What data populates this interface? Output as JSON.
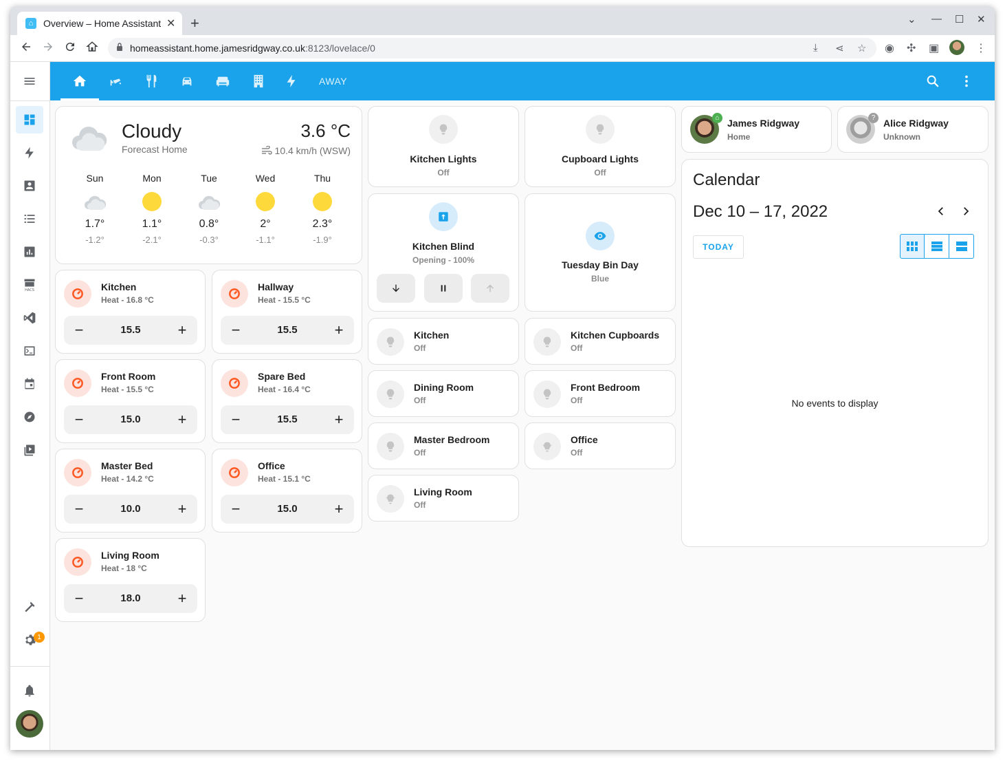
{
  "browser": {
    "tab_title": "Overview – Home Assistant",
    "url_host": "homeassistant.home.jamesridgway.co.uk",
    "url_path": ":8123/lovelace/0"
  },
  "header": {
    "away_label": "AWAY"
  },
  "weather": {
    "condition": "Cloudy",
    "name": "Forecast Home",
    "temperature": "3.6 °C",
    "wind": "10.4 km/h (WSW)",
    "forecast": [
      {
        "day": "Sun",
        "icon": "cloudy",
        "high": "1.7°",
        "low": "-1.2°"
      },
      {
        "day": "Mon",
        "icon": "sunny",
        "high": "1.1°",
        "low": "-2.1°"
      },
      {
        "day": "Tue",
        "icon": "cloudy",
        "high": "0.8°",
        "low": "-0.3°"
      },
      {
        "day": "Wed",
        "icon": "sunny",
        "high": "2°",
        "low": "-1.1°"
      },
      {
        "day": "Thu",
        "icon": "sunny",
        "high": "2.3°",
        "low": "-1.9°"
      }
    ]
  },
  "thermostats": [
    {
      "name": "Kitchen",
      "state": "Heat - 16.8 °C",
      "target": "15.5"
    },
    {
      "name": "Hallway",
      "state": "Heat - 15.5 °C",
      "target": "15.5"
    },
    {
      "name": "Front Room",
      "state": "Heat - 15.5 °C",
      "target": "15.0"
    },
    {
      "name": "Spare Bed",
      "state": "Heat - 16.4 °C",
      "target": "15.5"
    },
    {
      "name": "Master Bed",
      "state": "Heat - 14.2 °C",
      "target": "10.0"
    },
    {
      "name": "Office",
      "state": "Heat - 15.1 °C",
      "target": "15.0"
    },
    {
      "name": "Living Room",
      "state": "Heat - 18 °C",
      "target": "18.0"
    }
  ],
  "buttons": {
    "kitchen_lights": {
      "name": "Kitchen Lights",
      "state": "Off"
    },
    "cupboard_lights": {
      "name": "Cupboard Lights",
      "state": "Off"
    },
    "kitchen_blind": {
      "name": "Kitchen Blind",
      "state": "Opening - 100%"
    },
    "bin_day": {
      "name": "Tuesday Bin Day",
      "state": "Blue"
    }
  },
  "lights": [
    {
      "name": "Kitchen",
      "state": "Off"
    },
    {
      "name": "Kitchen Cupboards",
      "state": "Off"
    },
    {
      "name": "Dining Room",
      "state": "Off"
    },
    {
      "name": "Front Bedroom",
      "state": "Off"
    },
    {
      "name": "Master Bedroom",
      "state": "Off"
    },
    {
      "name": "Office",
      "state": "Off"
    },
    {
      "name": "Living Room",
      "state": "Off"
    }
  ],
  "people": [
    {
      "name": "James Ridgway",
      "state": "Home"
    },
    {
      "name": "Alice Ridgway",
      "state": "Unknown"
    }
  ],
  "calendar": {
    "title": "Calendar",
    "range": "Dec 10 – 17, 2022",
    "today_label": "TODAY",
    "empty_text": "No events to display"
  },
  "sidebar": {
    "notification_badge": "1"
  },
  "colors": {
    "accent": "#1aa3ea",
    "heat": "#ff5722",
    "sun": "#fdd93c"
  }
}
